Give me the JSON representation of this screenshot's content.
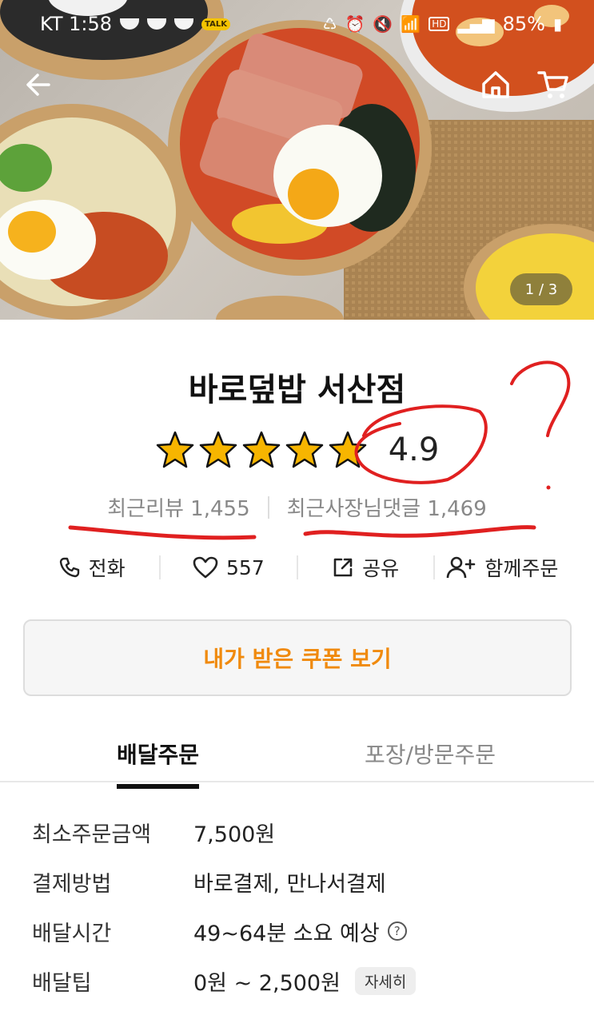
{
  "status_bar": {
    "carrier_time": "KT 1:58",
    "talk_badge": "TALK",
    "battery": "85%",
    "hd": "HD"
  },
  "hero": {
    "pager": "1 / 3"
  },
  "store": {
    "name": "바로덮밥 서산점",
    "rating": "4.9",
    "stars": 4.9,
    "recent_reviews": "최근리뷰 1,455",
    "owner_replies": "최근사장님댓글 1,469"
  },
  "actions": [
    {
      "label": "전화",
      "icon": "phone-icon"
    },
    {
      "label": "557",
      "icon": "heart-icon"
    },
    {
      "label": "공유",
      "icon": "share-icon"
    },
    {
      "label": "함께주문",
      "icon": "add-person-icon"
    }
  ],
  "coupon_button": "내가 받은 쿠폰 보기",
  "tabs": {
    "delivery": "배달주문",
    "pickup": "포장/방문주문"
  },
  "info": {
    "min_order_label": "최소주문금액",
    "min_order_value": "7,500원",
    "payment_label": "결제방법",
    "payment_value": "바로결제, 만나서결제",
    "delivery_time_label": "배달시간",
    "delivery_time_value": "49~64분 소요 예상",
    "delivery_tip_label": "배달팁",
    "delivery_tip_value": "0원 ~ 2,500원",
    "detail_chip": "자세히",
    "help_glyph": "?"
  },
  "colors": {
    "accent": "#f08a0e",
    "star": "#f7b500",
    "annotation": "#e02020"
  }
}
